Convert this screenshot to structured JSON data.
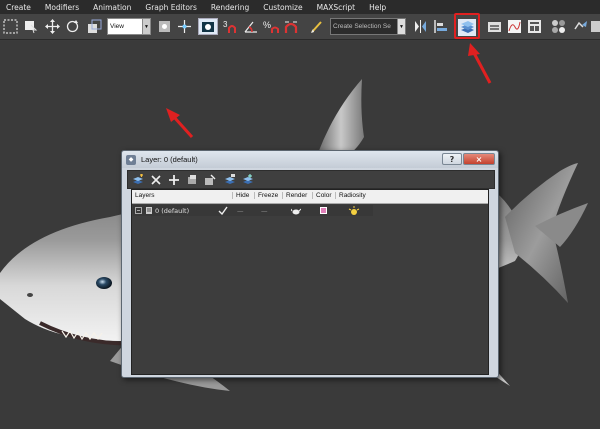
{
  "menubar": {
    "items": [
      "Create",
      "Modifiers",
      "Animation",
      "Graph Editors",
      "Rendering",
      "Customize",
      "MAXScript",
      "Help"
    ]
  },
  "toolbar": {
    "view_select": "View",
    "snap_angle": "3",
    "percent_label": "%",
    "selection_set": "Create Selection Se",
    "highlight_color": "#e02020"
  },
  "dialog": {
    "title": "Layer: 0 (default)",
    "help_label": "?",
    "close_label": "×",
    "columns": [
      "Layers",
      "Hide",
      "Freeze",
      "Render",
      "Color",
      "Radiosity"
    ],
    "rows": [
      {
        "name": "0 (default)",
        "hide": "—",
        "freeze": "—",
        "color": "#e07fb8"
      }
    ]
  },
  "annotations": {
    "arrow_color": "#e02020"
  }
}
